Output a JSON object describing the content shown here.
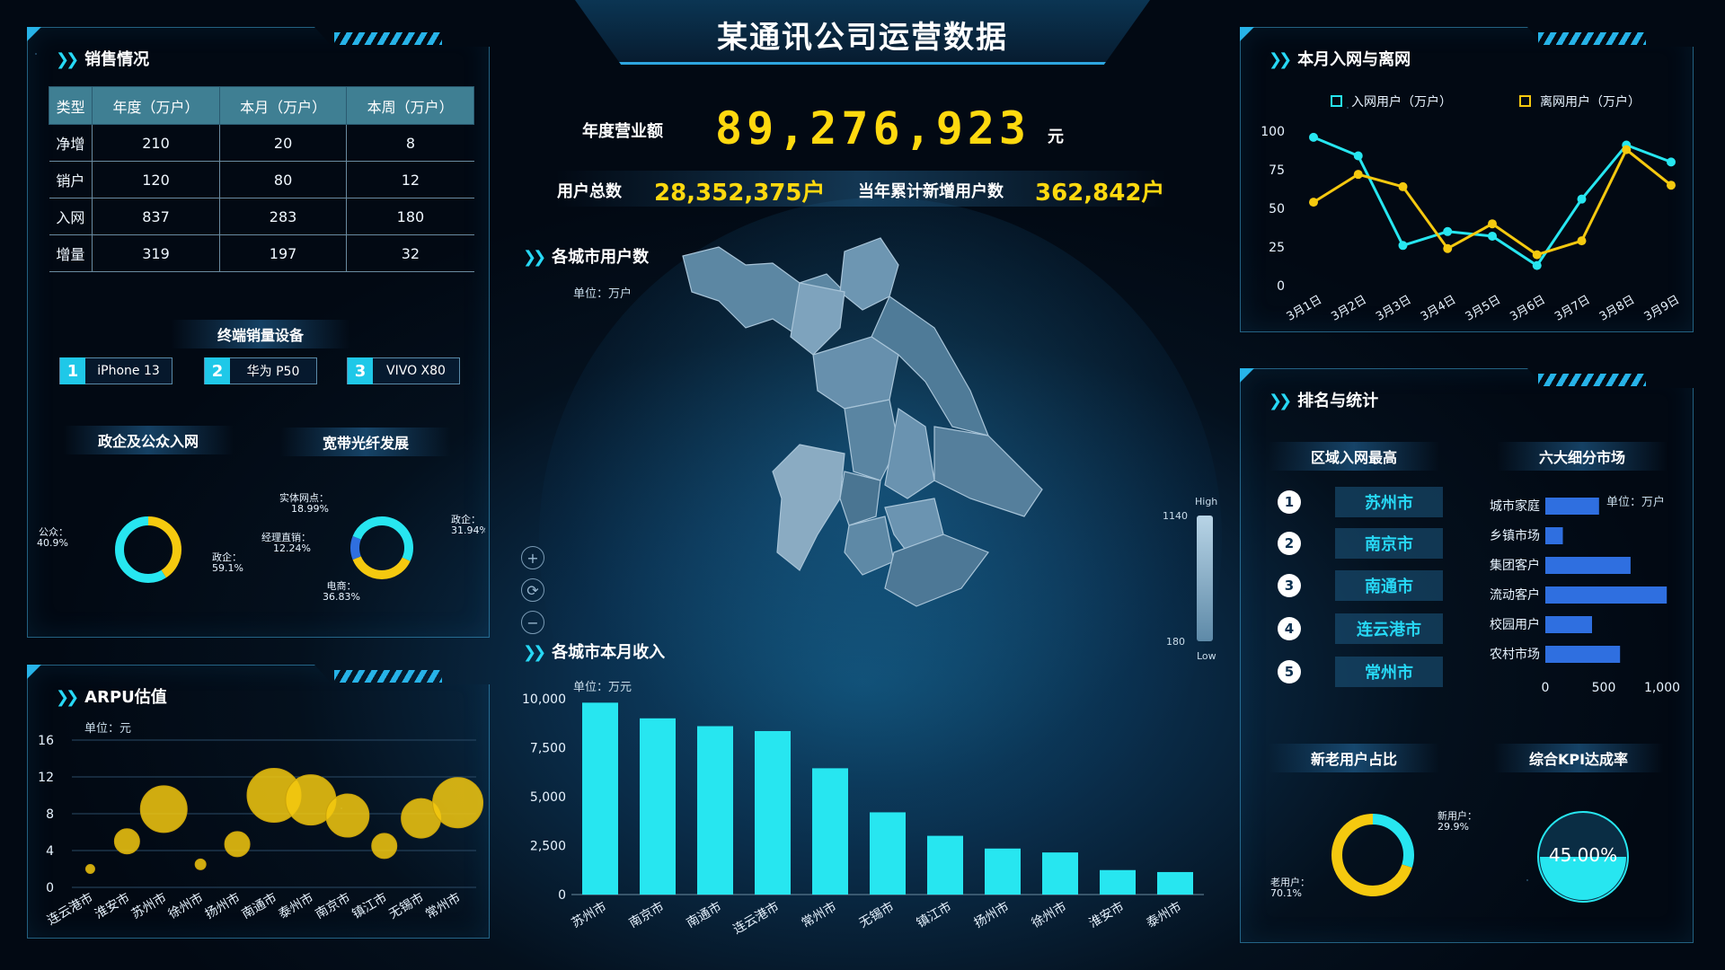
{
  "header": {
    "title": "某通讯公司运营数据"
  },
  "kpis": {
    "revenue_label": "年度营业额",
    "revenue_value": "89,276,923",
    "revenue_unit": "元",
    "users_label": "用户总数",
    "users_value": "28,352,375户",
    "new_users_label": "当年累计新增用户数",
    "new_users_value": "362,842户"
  },
  "sales": {
    "title": "销售情况",
    "columns": [
      "类型",
      "年度（万户）",
      "本月（万户）",
      "本周（万户）"
    ],
    "rows": [
      [
        "净增",
        "210",
        "20",
        "8"
      ],
      [
        "销户",
        "120",
        "80",
        "12"
      ],
      [
        "入网",
        "837",
        "283",
        "180"
      ],
      [
        "增量",
        "319",
        "197",
        "32"
      ]
    ],
    "devices_title": "终端销量设备",
    "devices": [
      {
        "rank": "1",
        "name": "iPhone 13"
      },
      {
        "rank": "2",
        "name": "华为 P50"
      },
      {
        "rank": "3",
        "name": "VIVO X80"
      }
    ],
    "gov_title": "政企及公众入网",
    "fiber_title": "宽带光纤发展"
  },
  "arpu": {
    "title": "ARPU估值",
    "unit": "单位：元"
  },
  "map": {
    "title": "各城市用户数",
    "unit": "单位：万户",
    "scale_high": "High",
    "scale_low": "Low",
    "scale_max": "1140",
    "scale_min": "180"
  },
  "revenue_bar": {
    "title": "各城市本月收入",
    "unit": "单位：万元"
  },
  "network": {
    "title": "本月入网与离网"
  },
  "ranking": {
    "title": "排名与统计",
    "region_title": "区域入网最高",
    "regions": [
      {
        "rank": "1",
        "city": "苏州市"
      },
      {
        "rank": "2",
        "city": "南京市"
      },
      {
        "rank": "3",
        "city": "南通市"
      },
      {
        "rank": "4",
        "city": "连云港市"
      },
      {
        "rank": "5",
        "city": "常州市"
      }
    ],
    "market_title": "六大细分市场",
    "market_unit": "单位：万户",
    "newold_title": "新老用户占比",
    "kpi_title": "综合KPI达成率",
    "kpi_value": "45.00%"
  },
  "colors": {
    "cyan": "#27e6f0",
    "yellow": "#f5c90f",
    "blue": "#2f6fe0",
    "panel_border": "#3fa9d8"
  },
  "chart_data": [
    {
      "type": "pie",
      "name": "gov_public",
      "labels": [
        "公众",
        "政企"
      ],
      "values": [
        40.9,
        59.1
      ],
      "display": [
        "公众：\n40.9%",
        "政企：\n59.1%"
      ],
      "colors": [
        "#f5c90f",
        "#27e6f0"
      ]
    },
    {
      "type": "pie",
      "name": "fiber",
      "labels": [
        "政企",
        "电商",
        "经理直销",
        "实体网点"
      ],
      "values": [
        31.94,
        36.83,
        12.24,
        18.99
      ],
      "display": [
        "政企：\n31.94%",
        "电商：\n36.83%",
        "经理直销：\n12.24%",
        "实体网点：\n18.99%"
      ],
      "colors": [
        "#27e6f0",
        "#f5c90f",
        "#2f6fe0",
        "#27e6f0"
      ]
    },
    {
      "type": "scatter",
      "name": "arpu",
      "categories": [
        "连云港市",
        "淮安市",
        "苏州市",
        "徐州市",
        "扬州市",
        "南通市",
        "泰州市",
        "南京市",
        "镇江市",
        "无锡市",
        "常州市"
      ],
      "values": [
        2,
        5,
        8.5,
        2.5,
        4.7,
        10,
        9.5,
        7.8,
        4.5,
        7.5,
        9.2
      ],
      "sizes": [
        5,
        14,
        26,
        6,
        14,
        30,
        28,
        24,
        14,
        22,
        28
      ],
      "ylim": [
        0,
        16
      ],
      "yticks": [
        "0",
        "4",
        "8",
        "12",
        "16"
      ]
    },
    {
      "type": "bar",
      "name": "city_revenue",
      "categories": [
        "苏州市",
        "南京市",
        "南通市",
        "连云港市",
        "常州市",
        "无锡市",
        "镇江市",
        "扬州市",
        "徐州市",
        "淮安市",
        "泰州市"
      ],
      "values": [
        9800,
        9000,
        8600,
        8350,
        6450,
        4200,
        3000,
        2350,
        2150,
        1250,
        1150
      ],
      "ylim": [
        0,
        10000
      ],
      "yticks": [
        "0",
        "2,500",
        "5,000",
        "7,500",
        "10,000"
      ]
    },
    {
      "type": "line",
      "name": "join_leave",
      "categories": [
        "3月1日",
        "3月2日",
        "3月3日",
        "3月4日",
        "3月5日",
        "3月6日",
        "3月7日",
        "3月8日",
        "3月9日"
      ],
      "series": [
        {
          "name": "入网用户（万户）",
          "values": [
            96,
            84,
            26,
            35,
            32,
            13,
            56,
            91,
            80
          ],
          "color": "#27e6f0"
        },
        {
          "name": "离网用户（万户）",
          "values": [
            54,
            72,
            64,
            24,
            40,
            20,
            29,
            88,
            65
          ],
          "color": "#f5c90f"
        }
      ],
      "ylim": [
        0,
        100
      ],
      "yticks": [
        "0",
        "25",
        "50",
        "75",
        "100"
      ]
    },
    {
      "type": "bar",
      "name": "six_markets",
      "categories": [
        "城市家庭",
        "乡镇市场",
        "集团客户",
        "流动客户",
        "校园用户",
        "农村市场"
      ],
      "values": [
        460,
        150,
        730,
        1040,
        400,
        640
      ],
      "xlim": [
        0,
        1000
      ],
      "xticks": [
        "0",
        "500",
        "1,000"
      ]
    },
    {
      "type": "pie",
      "name": "new_old",
      "labels": [
        "新用户",
        "老用户"
      ],
      "values": [
        29.9,
        70.1
      ],
      "display": [
        "新用户：\n29.9%",
        "老用户：\n70.1%"
      ],
      "colors": [
        "#27e6f0",
        "#f5c90f"
      ]
    }
  ]
}
